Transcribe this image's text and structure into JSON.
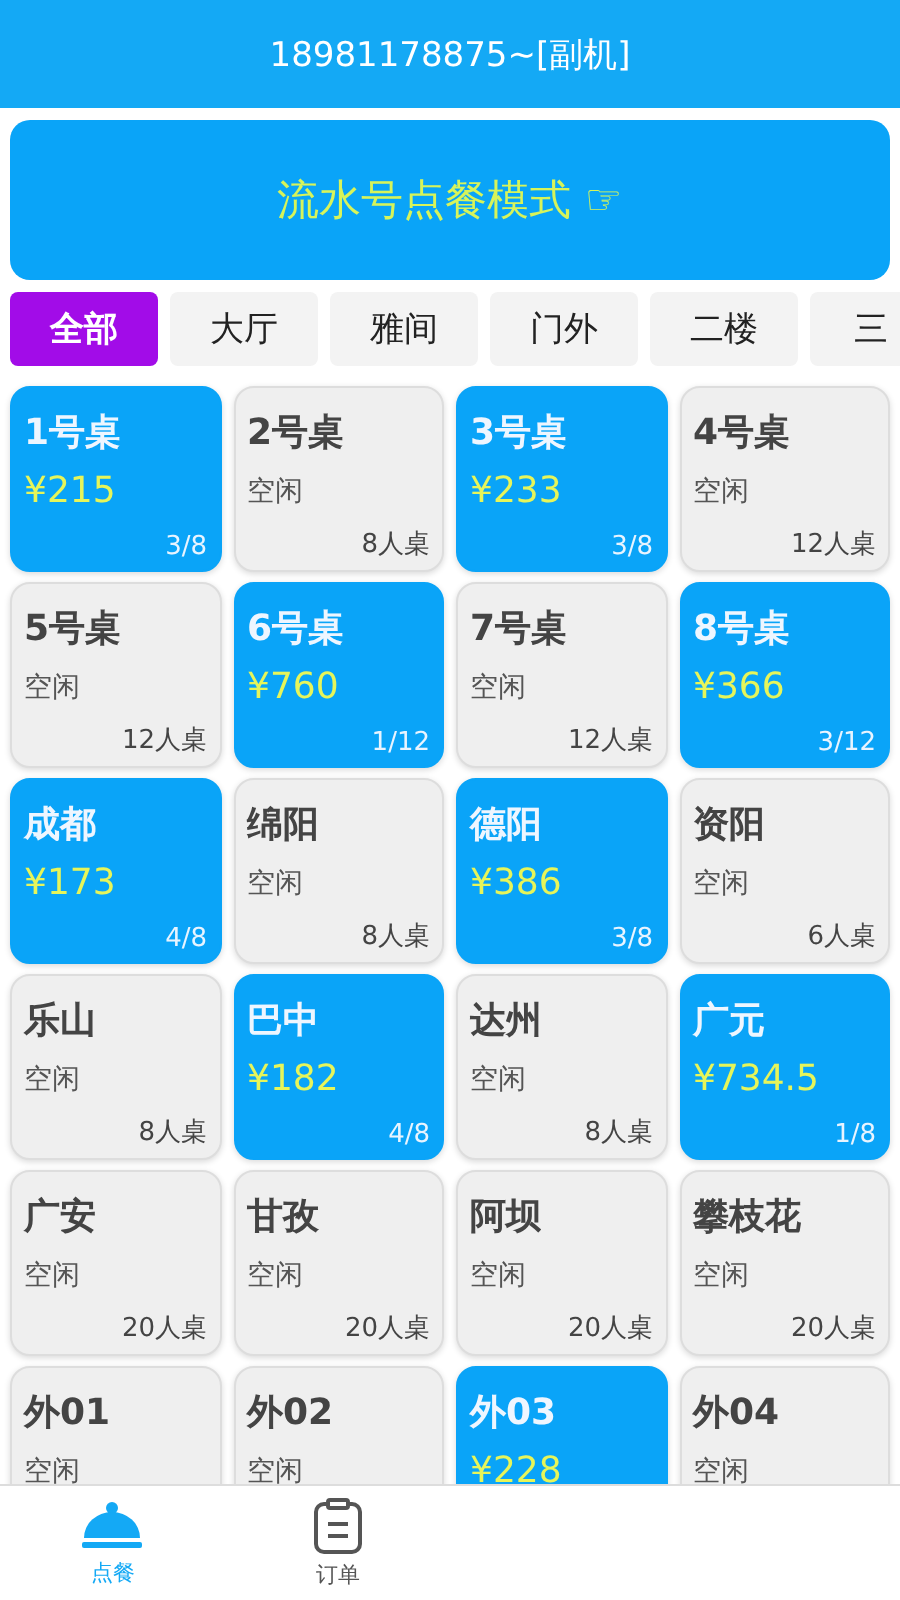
{
  "header": {
    "title": "18981178875~[副机]"
  },
  "banner": {
    "label": "流水号点餐模式 ☞"
  },
  "tabs": [
    {
      "label": "全部",
      "selected": true
    },
    {
      "label": "大厅",
      "selected": false
    },
    {
      "label": "雅间",
      "selected": false
    },
    {
      "label": "门外",
      "selected": false
    },
    {
      "label": "二楼",
      "selected": false
    },
    {
      "label": "三",
      "selected": false
    }
  ],
  "tables": [
    {
      "name": "1号桌",
      "occupied": true,
      "info": "¥215",
      "seats": "3/8"
    },
    {
      "name": "2号桌",
      "occupied": false,
      "info": "空闲",
      "seats": "8人桌"
    },
    {
      "name": "3号桌",
      "occupied": true,
      "info": "¥233",
      "seats": "3/8"
    },
    {
      "name": "4号桌",
      "occupied": false,
      "info": "空闲",
      "seats": "12人桌"
    },
    {
      "name": "5号桌",
      "occupied": false,
      "info": "空闲",
      "seats": "12人桌"
    },
    {
      "name": "6号桌",
      "occupied": true,
      "info": "¥760",
      "seats": "1/12"
    },
    {
      "name": "7号桌",
      "occupied": false,
      "info": "空闲",
      "seats": "12人桌"
    },
    {
      "name": "8号桌",
      "occupied": true,
      "info": "¥366",
      "seats": "3/12"
    },
    {
      "name": "成都",
      "occupied": true,
      "info": "¥173",
      "seats": "4/8"
    },
    {
      "name": "绵阳",
      "occupied": false,
      "info": "空闲",
      "seats": "8人桌"
    },
    {
      "name": "德阳",
      "occupied": true,
      "info": "¥386",
      "seats": "3/8"
    },
    {
      "name": "资阳",
      "occupied": false,
      "info": "空闲",
      "seats": "6人桌"
    },
    {
      "name": "乐山",
      "occupied": false,
      "info": "空闲",
      "seats": "8人桌"
    },
    {
      "name": "巴中",
      "occupied": true,
      "info": "¥182",
      "seats": "4/8"
    },
    {
      "name": "达州",
      "occupied": false,
      "info": "空闲",
      "seats": "8人桌"
    },
    {
      "name": "广元",
      "occupied": true,
      "info": "¥734.5",
      "seats": "1/8"
    },
    {
      "name": "广安",
      "occupied": false,
      "info": "空闲",
      "seats": "20人桌"
    },
    {
      "name": "甘孜",
      "occupied": false,
      "info": "空闲",
      "seats": "20人桌"
    },
    {
      "name": "阿坝",
      "occupied": false,
      "info": "空闲",
      "seats": "20人桌"
    },
    {
      "name": "攀枝花",
      "occupied": false,
      "info": "空闲",
      "seats": "20人桌"
    },
    {
      "name": "外01",
      "occupied": false,
      "info": "空闲"
    },
    {
      "name": "外02",
      "occupied": false,
      "info": "空闲"
    },
    {
      "name": "外03",
      "occupied": true,
      "info": "¥228"
    },
    {
      "name": "外04",
      "occupied": false,
      "info": "空闲"
    }
  ],
  "bottom_nav": [
    {
      "label": "点餐",
      "kind": "cloche",
      "selected": true
    },
    {
      "label": "订单",
      "kind": "clipboard",
      "selected": false
    }
  ]
}
